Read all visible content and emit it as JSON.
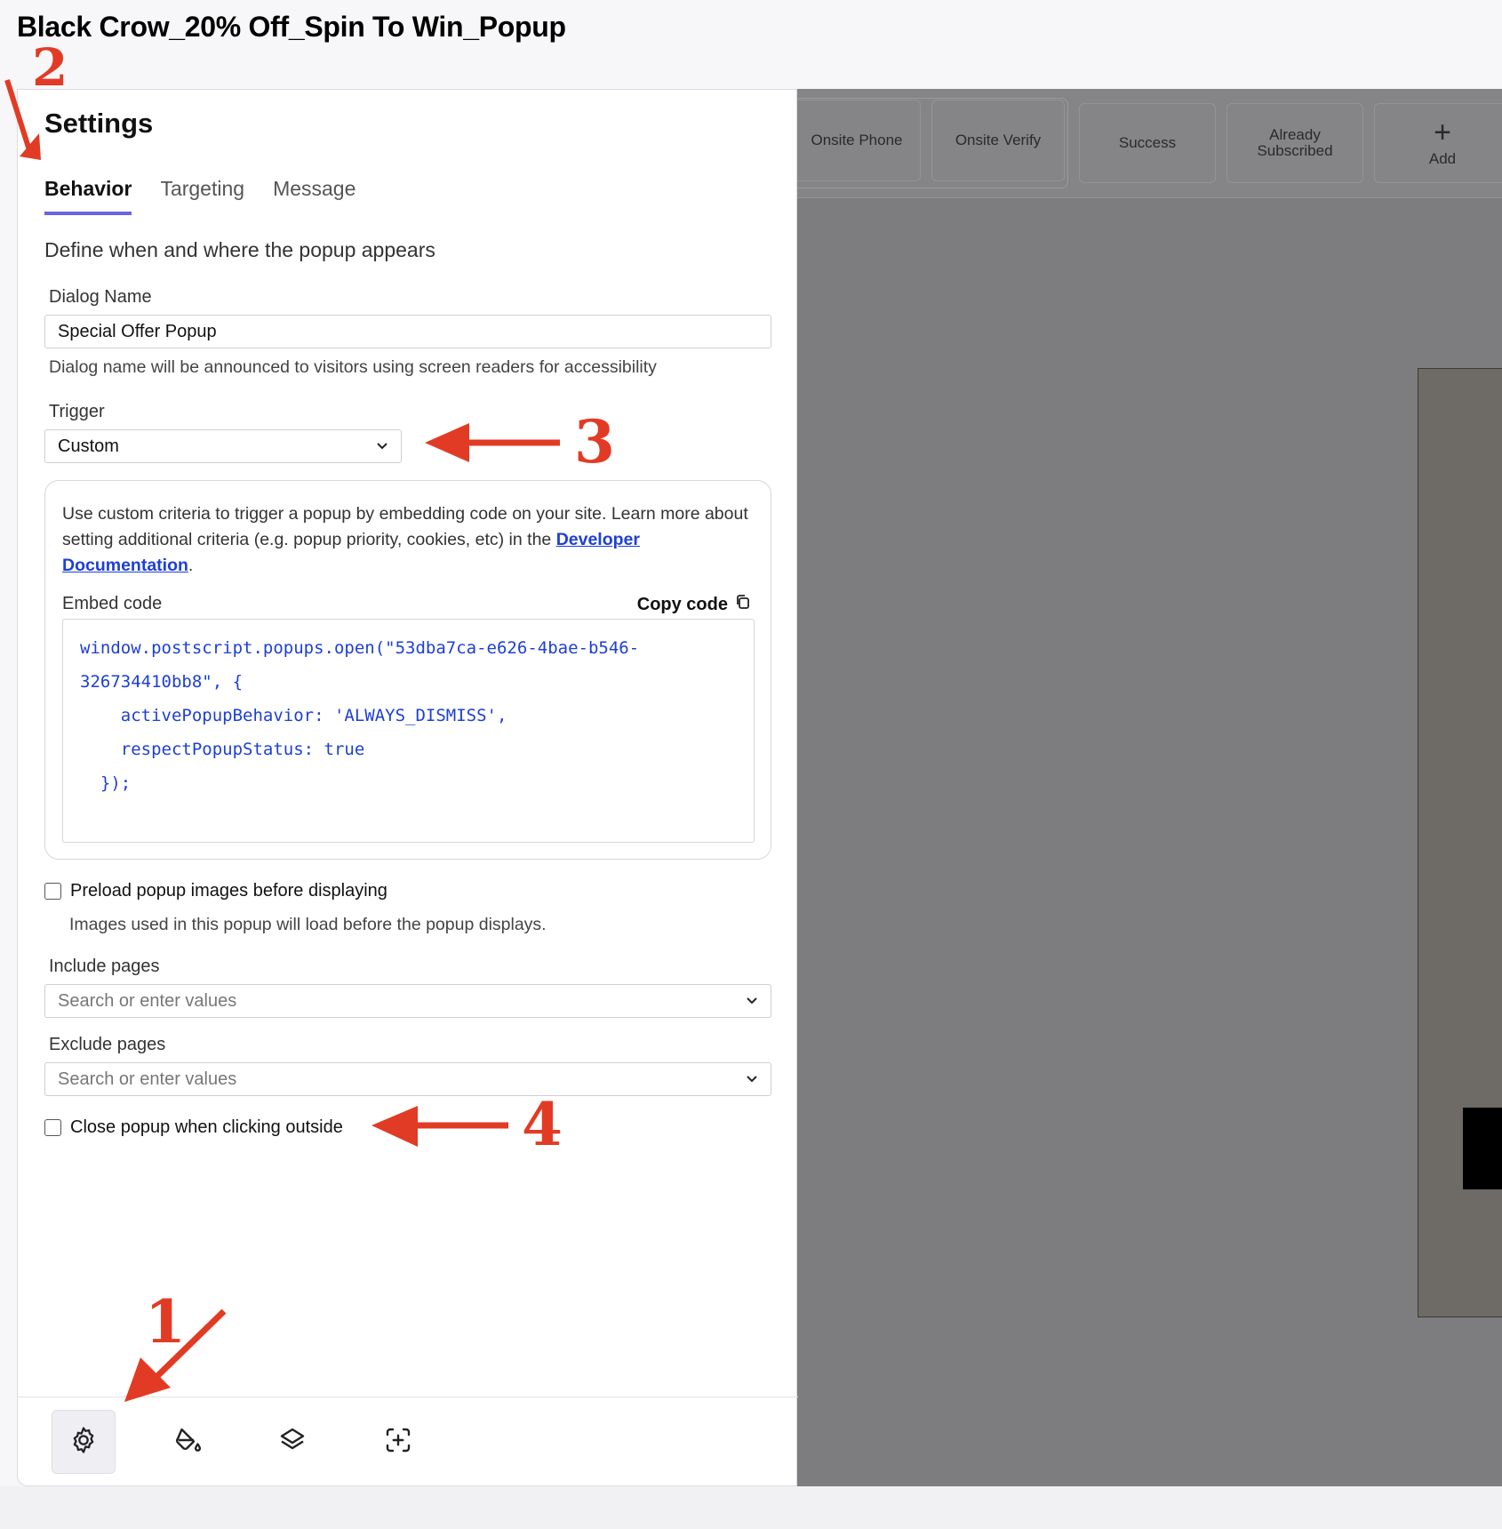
{
  "page": {
    "title": "Black Crow_20% Off_Spin To Win_Popup"
  },
  "steps": [
    {
      "label": "Onsite Phone"
    },
    {
      "label": "Onsite Verify"
    },
    {
      "label": "Success"
    },
    {
      "label": "Already Subscribed"
    },
    {
      "label": "Add",
      "icon": "plus-icon"
    }
  ],
  "settings": {
    "title": "Settings",
    "tabs": [
      {
        "label": "Behavior",
        "active": true
      },
      {
        "label": "Targeting",
        "active": false
      },
      {
        "label": "Message",
        "active": false
      }
    ],
    "subtitle": "Define when and where the popup appears",
    "dialog_name": {
      "label": "Dialog Name",
      "value": "Special Offer Popup",
      "helper": "Dialog name will be announced to visitors using screen readers for accessibility"
    },
    "trigger": {
      "label": "Trigger",
      "value": "Custom"
    },
    "custom_info": {
      "text": "Use custom criteria to trigger a popup by embedding code on your site. Learn more about setting additional criteria (e.g. popup priority, cookies, etc) in the ",
      "link": "Developer Documentation",
      "after_link": ".",
      "embed_label": "Embed code",
      "copy_label": "Copy code",
      "code": "window.postscript.popups.open(\"53dba7ca-e626-4bae-b546-\n326734410bb8\", {\n    activePopupBehavior: 'ALWAYS_DISMISS',\n    respectPopupStatus: true\n  });"
    },
    "preload": {
      "label": "Preload popup images before displaying",
      "checked": false,
      "helper": "Images used in this popup will load before the popup displays."
    },
    "include_pages": {
      "label": "Include pages",
      "placeholder": "Search or enter values"
    },
    "exclude_pages": {
      "label": "Exclude pages",
      "placeholder": "Search or enter values"
    },
    "close_outside": {
      "label": "Close popup when clicking outside",
      "checked": false
    }
  },
  "footer_tools": [
    {
      "icon": "gear-icon",
      "active": true
    },
    {
      "icon": "paint-bucket-icon",
      "active": false
    },
    {
      "icon": "layers-icon",
      "active": false
    },
    {
      "icon": "add-element-icon",
      "active": false
    }
  ],
  "annotations": [
    "1",
    "2",
    "3",
    "4"
  ],
  "colors": {
    "accent": "#6b63e0",
    "link": "#1d3fd6",
    "annotation": "#e23b25",
    "canvas": "#7d7d7f"
  }
}
